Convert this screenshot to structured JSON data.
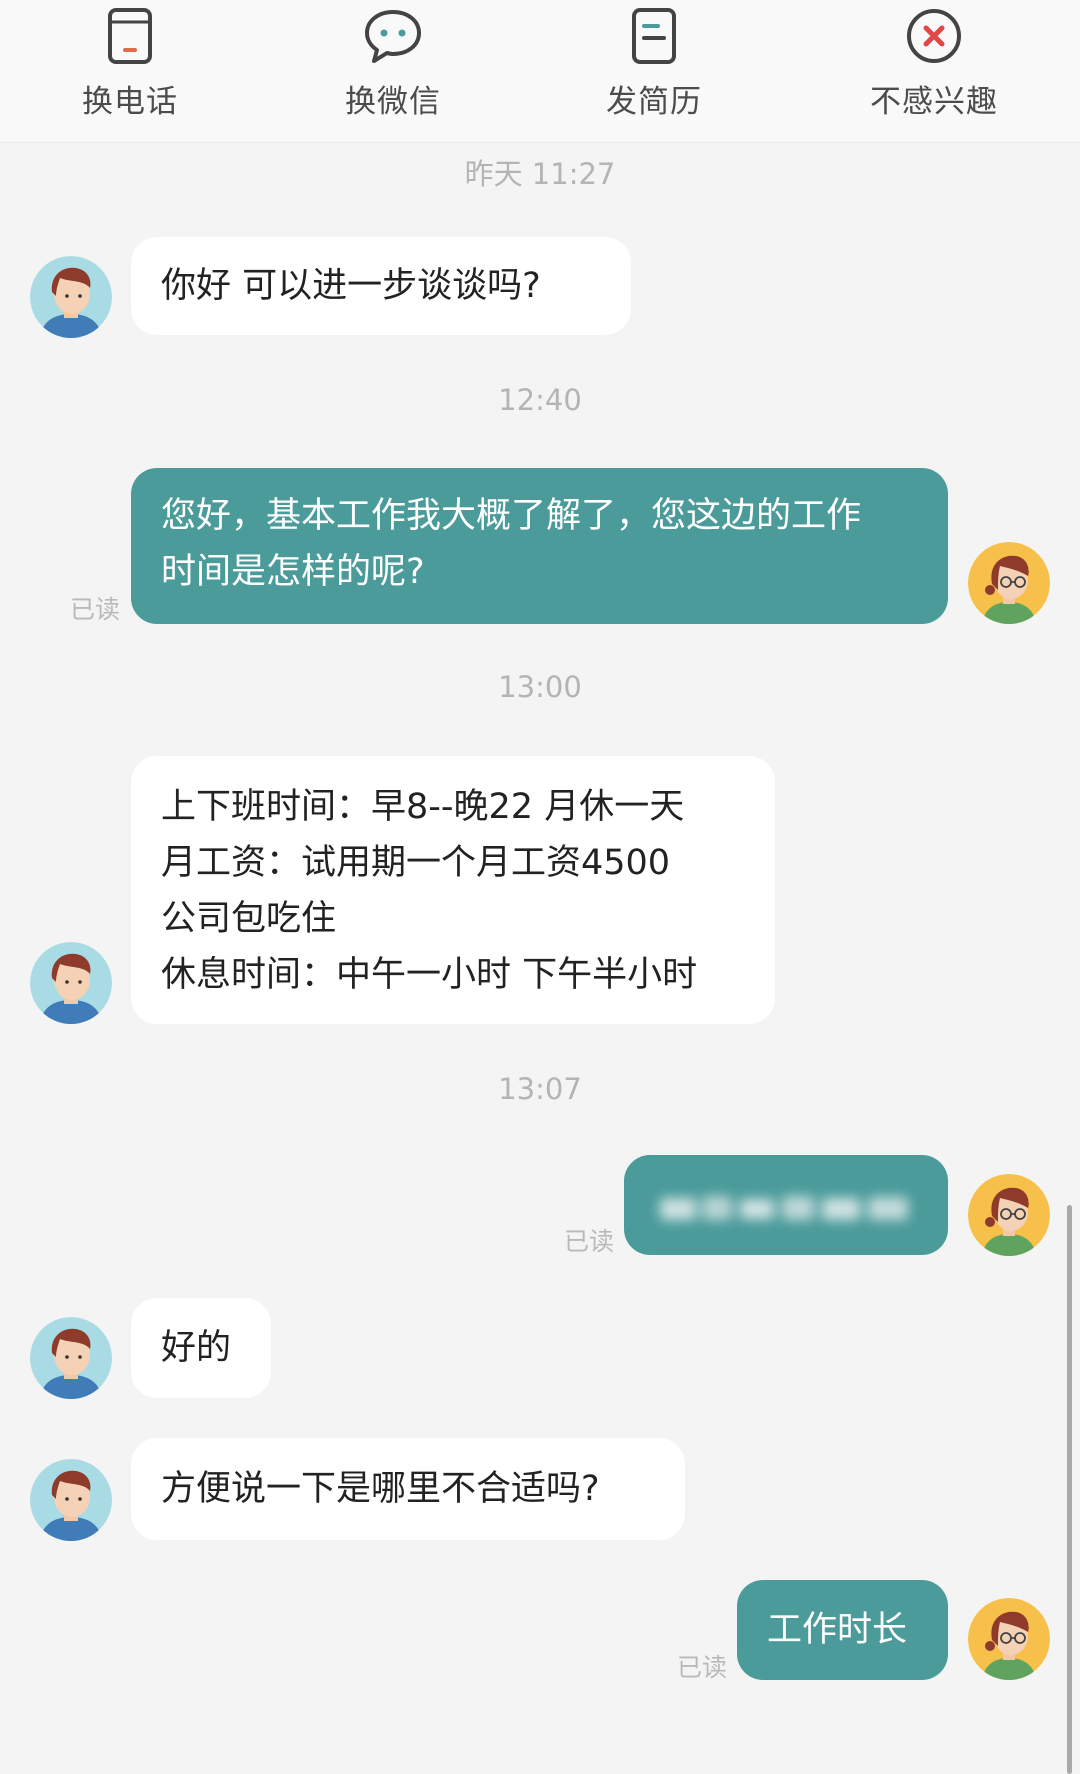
{
  "actions": [
    {
      "label": "换电话",
      "icon": "phone-icon"
    },
    {
      "label": "换微信",
      "icon": "wechat-icon"
    },
    {
      "label": "发简历",
      "icon": "resume-icon"
    },
    {
      "label": "不感兴趣",
      "icon": "not-interested-icon"
    }
  ],
  "colors": {
    "accent": "#4b9b9b",
    "background": "#f4f4f4",
    "incoming_bubble": "#ffffff",
    "not_interested_red": "#e04848"
  },
  "messages": {
    "t1": "昨天 11:27",
    "m1": "你好  可以进一步谈谈吗?",
    "t2": "12:40",
    "m2_line1": "您好，基本工作我大概了解了，您这边的工作",
    "m2_line2": "时间是怎样的呢?",
    "m2_read": "已读",
    "t3": "13:00",
    "m3_line1": "上下班时间：早8--晚22 月休一天",
    "m3_line2": "月工资：试用期一个月工资4500",
    "m3_line3": "公司包吃住",
    "m3_line4": "休息时间：中午一小时 下午半小时",
    "t4": "13:07",
    "m4_read": "已读",
    "m5": "好的",
    "m6": "方便说一下是哪里不合适吗?",
    "m7": "工作时长",
    "m7_read": "已读"
  }
}
